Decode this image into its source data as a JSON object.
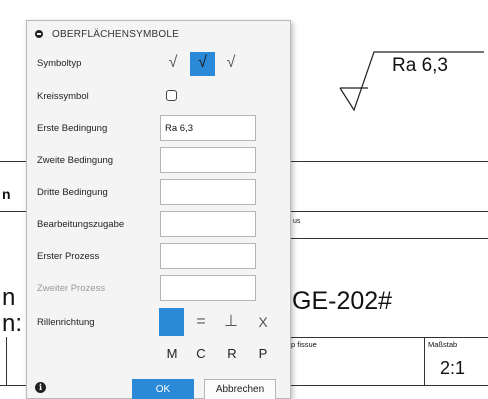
{
  "background": {
    "roughness_symbol_text": "Ra 6,3",
    "drawing_number_fragment": "GE-202#",
    "issue_label": "p fissue",
    "us_fragment": "us",
    "scale_label": "Maßstab",
    "scale_value": "2:1",
    "left_fragment_1": "n",
    "left_fragment_2": "n",
    "left_fragment_3": "n:"
  },
  "dialog": {
    "title": "OBERFLÄCHENSYMBOLE",
    "fields": {
      "symbol_type_label": "Symboltyp",
      "circle_symbol_label": "Kreissymbol",
      "first_condition_label": "Erste Bedingung",
      "first_condition_value": "Ra 6,3",
      "second_condition_label": "Zweite Bedingung",
      "second_condition_value": "",
      "third_condition_label": "Dritte Bedingung",
      "third_condition_value": "",
      "machining_allowance_label": "Bearbeitungszugabe",
      "machining_allowance_value": "",
      "first_process_label": "Erster Prozess",
      "first_process_value": "",
      "second_process_label": "Zweiter Prozess",
      "second_process_value": "",
      "lay_direction_label": "Rillenrichtung"
    },
    "symbol_types": [
      "√",
      "√",
      "√"
    ],
    "symbol_type_selected": 1,
    "circle_symbol_checked": false,
    "lay_symbols": [
      "=",
      "⊥",
      "X"
    ],
    "lay_letters": [
      "M",
      "C",
      "R",
      "P"
    ],
    "ok_label": "OK",
    "cancel_label": "Abbrechen",
    "accent_color": "#2a8ad8"
  }
}
